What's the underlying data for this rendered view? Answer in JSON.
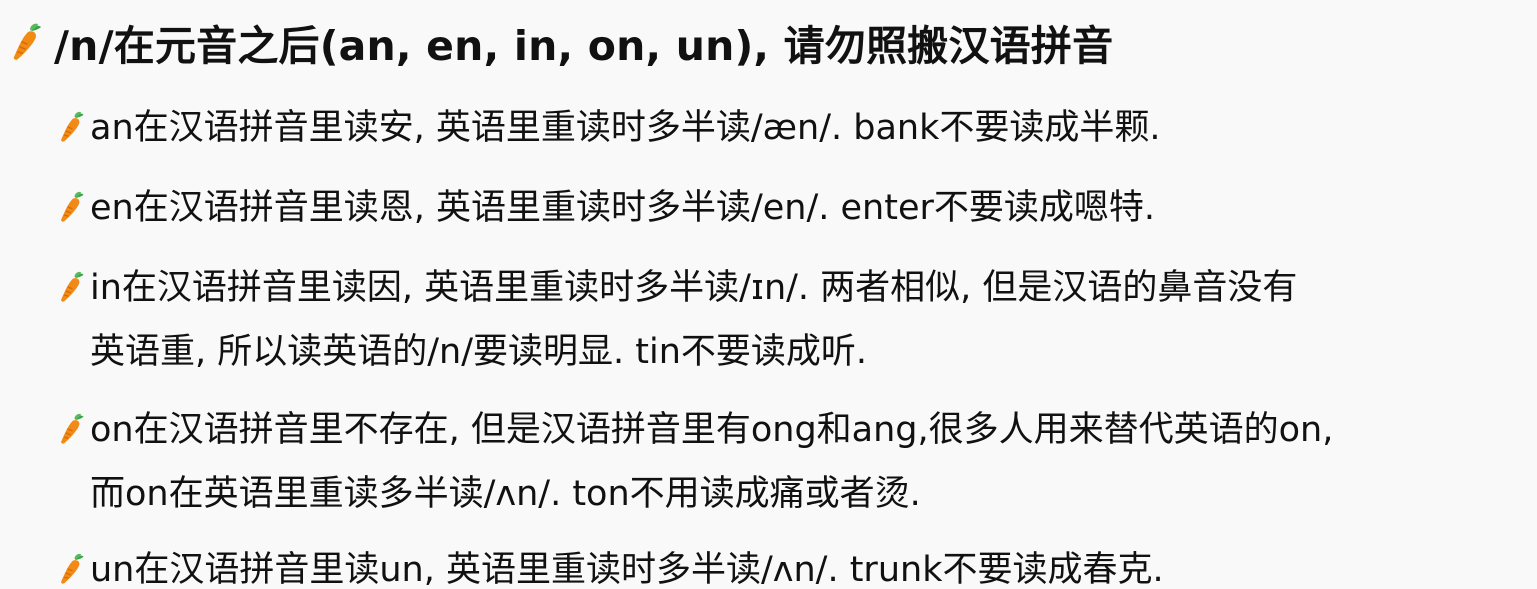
{
  "heading": {
    "text": "/n/在元音之后(an, en, in, on, un), 请勿照搬汉语拼音"
  },
  "bullets": [
    {
      "line1": "an在汉语拼音里读安, 英语里重读时多半读/æn/. bank不要读成半颗."
    },
    {
      "line1": "en在汉语拼音里读恩, 英语里重读时多半读/en/. enter不要读成嗯特."
    },
    {
      "line1": "in在汉语拼音里读因, 英语里重读时多半读/ɪn/. 两者相似, 但是汉语的鼻音没有",
      "line2": "英语重, 所以读英语的/n/要读明显. tin不要读成听."
    },
    {
      "line1": "on在汉语拼音里不存在, 但是汉语拼音里有ong和ang,很多人用来替代英语的on,",
      "line2": "而on在英语里重读多半读/ʌn/. ton不用读成痛或者烫."
    },
    {
      "line1": "un在汉语拼音里读un, 英语里重读时多半读/ʌn/. trunk不要读成春克."
    }
  ],
  "icons": {
    "bullet_icon": "carrot-icon"
  },
  "colors": {
    "background": "#f9f9f9",
    "text": "#111111",
    "carrot_body": "#f28a16",
    "carrot_leaf": "#3aa34a"
  }
}
